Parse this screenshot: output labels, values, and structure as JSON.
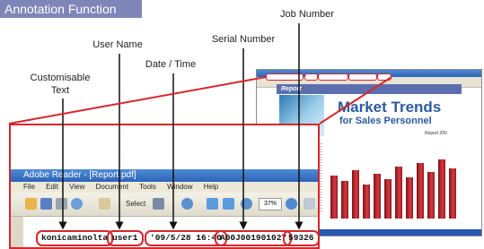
{
  "header": {
    "title": "Annotation Function"
  },
  "labels": {
    "customisable_text": "Customisable\nText",
    "user_name": "User Name",
    "date_time": "Date / Time",
    "serial_number": "Serial Number",
    "job_number": "Job Number"
  },
  "reader_window": {
    "title": "Adobe Reader - [Report.pdf]",
    "menu": [
      "File",
      "Edit",
      "View",
      "Document",
      "Tools",
      "Window",
      "Help"
    ],
    "select_label": "Select",
    "zoom_value": "37%"
  },
  "annotation": {
    "text": "konicaminolta",
    "user": "user1",
    "datetime": "'09/5/28 16:40",
    "serial": "A00J001901027",
    "job": "59326"
  },
  "document": {
    "section": "Report",
    "headline1": "Market Trends",
    "headline2": "for Sales Personnel",
    "report_label": "Report 200"
  },
  "colors": {
    "accent": "#d8262c",
    "header": "#7e86b8",
    "headline": "#2b5aa0"
  },
  "icons": [
    "open-icon",
    "save-icon",
    "print-icon",
    "search-icon",
    "zoom-in-icon",
    "zoom-out-icon"
  ]
}
